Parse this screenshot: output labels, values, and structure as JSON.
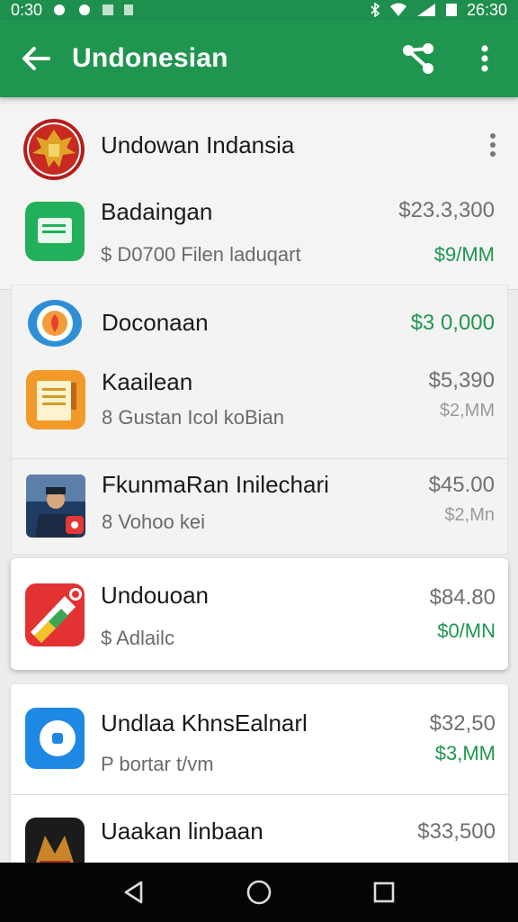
{
  "status_bar": {
    "time_left": "0:30",
    "time_right": "26:30"
  },
  "app_bar": {
    "title": "Undonesian"
  },
  "header_item": {
    "title": "Undowan Indansia"
  },
  "items": [
    {
      "title": "Badaingan",
      "subtitle": "$ D0700 Filen laduqart",
      "amount": "$23.3,300",
      "rate": "$9/MM",
      "amount_color": "gray",
      "rate_color": "green",
      "icon": "chat-app-icon"
    },
    {
      "title": "Doconaan",
      "subtitle": "",
      "amount": "$3 0,000",
      "rate": "",
      "amount_color": "green",
      "rate_color": "",
      "icon": "target-app-icon"
    },
    {
      "title": "Kaailean",
      "subtitle": "8 Gustan Icol koBian",
      "amount": "$5,390",
      "rate": "$2,MM",
      "amount_color": "gray",
      "rate_color": "gray",
      "icon": "notes-app-icon"
    },
    {
      "title": "FkunmaRan Inilechari",
      "subtitle": "8 Vohoo kei",
      "amount": "$45.00",
      "rate": "$2,Mn",
      "amount_color": "gray",
      "rate_color": "gray",
      "icon": "officer-photo-icon"
    },
    {
      "title": "Undouoan",
      "subtitle": "$ Adlailc",
      "amount": "$84.80",
      "rate": "$0/MN",
      "amount_color": "gray",
      "rate_color": "green",
      "icon": "red-app-icon"
    },
    {
      "title": "Undlaa KhnsEalnarl",
      "subtitle": "P bortar t/vm",
      "amount": "$32,50",
      "rate": "$3,MM",
      "amount_color": "gray",
      "rate_color": "green",
      "icon": "blue-app-icon"
    },
    {
      "title": "Uaakan linbaan",
      "subtitle": "",
      "amount": "$33,500",
      "rate": "",
      "amount_color": "gray",
      "rate_color": "",
      "icon": "dark-app-icon"
    }
  ],
  "colors": {
    "primary": "#20954f",
    "accent_green": "#1f9650",
    "nav_bar": "#050505"
  }
}
